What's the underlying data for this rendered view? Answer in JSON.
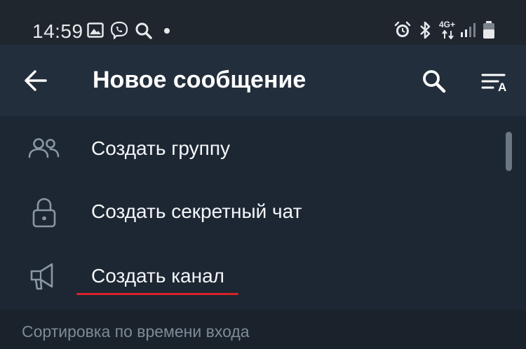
{
  "status_bar": {
    "time": "14:59",
    "left_icons": [
      "image-icon",
      "viber-icon",
      "search-icon",
      "dot-icon"
    ],
    "right_icons": [
      "alarm-icon",
      "bluetooth-icon",
      "network-4g-icon",
      "signal-icon",
      "battery-icon"
    ],
    "network_label": "4G+"
  },
  "header": {
    "title": "Новое сообщение",
    "back_icon": "arrow-left-icon",
    "search_icon": "search-icon",
    "sort_icon": "sort-alpha-icon",
    "sort_letter": "A"
  },
  "menu": {
    "items": [
      {
        "label": "Создать группу",
        "icon": "group-icon"
      },
      {
        "label": "Создать секретный чат",
        "icon": "lock-icon"
      },
      {
        "label": "Создать канал",
        "icon": "megaphone-icon"
      }
    ]
  },
  "section": {
    "label": "Сортировка по времени входа"
  },
  "colors": {
    "background": "#1d2733",
    "header": "#232e3c",
    "status_bar": "#1f262e",
    "text": "#ffffff",
    "muted_text": "#7e8a97",
    "icon": "#8b97a4",
    "underline": "#d9232a"
  }
}
